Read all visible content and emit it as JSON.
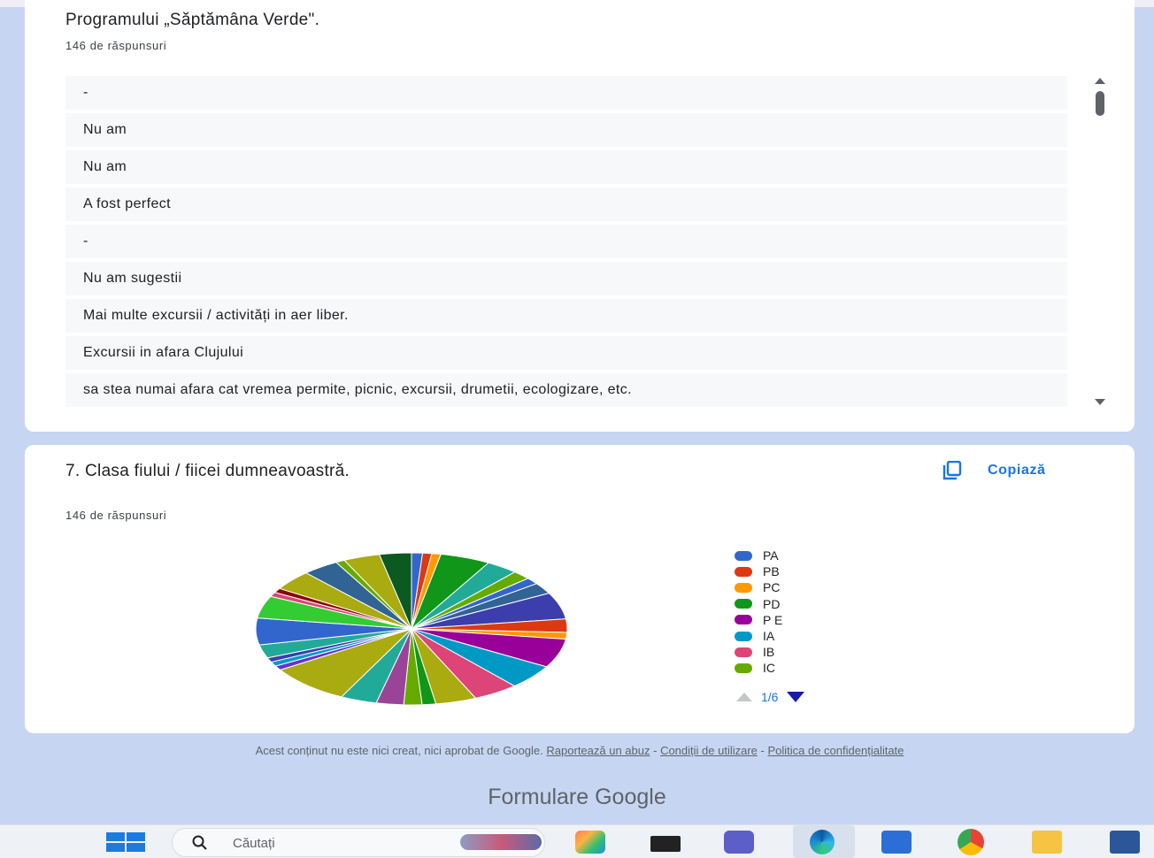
{
  "question6": {
    "title": "Programului „Săptămâna Verde\".",
    "count": "146 de răspunsuri",
    "answers": [
      "-",
      "Nu am",
      "Nu am",
      "A fost perfect",
      "-",
      "Nu am sugestii",
      "Mai multe excursii / activități in aer liber.",
      "Excursii in afara Clujului",
      "sa stea numai afara cat vremea permite, picnic, excursii, drumetii, ecologizare, etc."
    ]
  },
  "question7": {
    "title": "7. Clasa fiului / fiicei dumneavoastră.",
    "count": "146 de răspunsuri",
    "copy_label": "Copiază",
    "pager": "1/6"
  },
  "chart_data": {
    "type": "pie",
    "legend_position": "right",
    "legend": [
      {
        "label": "PA",
        "color": "#3366cc"
      },
      {
        "label": "PB",
        "color": "#dc3912"
      },
      {
        "label": "PC",
        "color": "#ff9900"
      },
      {
        "label": "PD",
        "color": "#109618"
      },
      {
        "label": "P E",
        "color": "#990099"
      },
      {
        "label": "IA",
        "color": "#0099c6"
      },
      {
        "label": "IB",
        "color": "#dd4477"
      },
      {
        "label": "IC",
        "color": "#66aa00"
      }
    ],
    "slices": [
      {
        "color": "#3366cc",
        "value": 1.2
      },
      {
        "color": "#dc3912",
        "value": 1.0
      },
      {
        "color": "#ff9900",
        "value": 1.0
      },
      {
        "color": "#109618",
        "value": 5.5
      },
      {
        "color": "#22aa99",
        "value": 3.5
      },
      {
        "color": "#66aa00",
        "value": 2.0
      },
      {
        "color": "#3366cc",
        "value": 1.5
      },
      {
        "color": "#316395",
        "value": 2.5
      },
      {
        "color": "#3b3eac",
        "value": 6.0
      },
      {
        "color": "#dc3912",
        "value": 3.0
      },
      {
        "color": "#ff9900",
        "value": 1.5
      },
      {
        "color": "#990099",
        "value": 6.5
      },
      {
        "color": "#0099c6",
        "value": 5.5
      },
      {
        "color": "#dd4477",
        "value": 5.0
      },
      {
        "color": "#aaaa11",
        "value": 4.5
      },
      {
        "color": "#109618",
        "value": 1.5
      },
      {
        "color": "#66aa00",
        "value": 2.0
      },
      {
        "color": "#994499",
        "value": 3.0
      },
      {
        "color": "#22aa99",
        "value": 4.0
      },
      {
        "color": "#aaaa11",
        "value": 9.0
      },
      {
        "color": "#6633cc",
        "value": 1.0
      },
      {
        "color": "#0099c6",
        "value": 1.0
      },
      {
        "color": "#3b3eac",
        "value": 1.0
      },
      {
        "color": "#22aa99",
        "value": 3.0
      },
      {
        "color": "#3366cc",
        "value": 6.0
      },
      {
        "color": "#33cc33",
        "value": 5.0
      },
      {
        "color": "#dd4477",
        "value": 1.0
      },
      {
        "color": "#8b0707",
        "value": 1.0
      },
      {
        "color": "#aaaa11",
        "value": 4.5
      },
      {
        "color": "#316395",
        "value": 4.0
      },
      {
        "color": "#66aa00",
        "value": 1.0
      },
      {
        "color": "#aaaa11",
        "value": 4.0
      },
      {
        "color": "#0c5922",
        "value": 3.5
      }
    ]
  },
  "footer": {
    "text": "Acest conținut nu este nici creat, nici aprobat de Google.",
    "link_abuse": "Raportează un abuz",
    "sep": " - ",
    "link_terms": "Condiții de utilizare",
    "link_privacy": "Politica de confidențialitate",
    "brand": "Formulare Google"
  },
  "taskbar": {
    "search_placeholder": "Căutați",
    "icons": [
      "windows-start-icon",
      "widgets-icon",
      "copilot-icon",
      "task-view-icon",
      "teams-icon",
      "edge-icon",
      "store-icon",
      "chrome-icon",
      "file-explorer-icon",
      "word-icon"
    ]
  }
}
